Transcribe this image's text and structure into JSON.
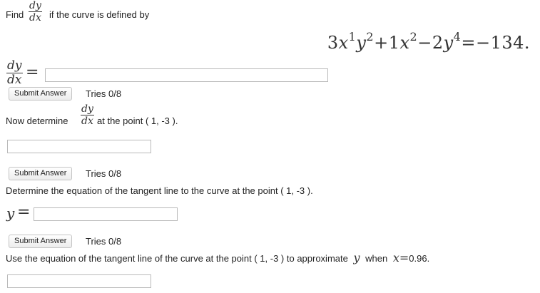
{
  "q1": {
    "find_word": "Find",
    "frac_num": "dy",
    "frac_den": "dx",
    "prompt_text": "if the curve is defined by",
    "equation": {
      "coef1": "3",
      "x1": "x",
      "exp_x1": "1",
      "y1": "y",
      "exp_y1": "2",
      "plus": "+1",
      "x2": "x",
      "exp_x2": "2",
      "minus": "−2",
      "y2": "y",
      "exp_y2": "4",
      "rhs": "=−134."
    },
    "answer_label_num": "dy",
    "answer_label_den": "dx",
    "equals": "=",
    "answer_value": "",
    "submit_label": "Submit Answer",
    "tries": "Tries 0/8"
  },
  "q2": {
    "prefix": "Now determine",
    "frac_num": "dy",
    "frac_den": "dx",
    "suffix": "at the point ( 1, -3 ).",
    "answer_value": "",
    "submit_label": "Submit Answer",
    "tries": "Tries 0/8"
  },
  "q3": {
    "prompt": "Determine the equation of the tangent line to the curve at the point ( 1, -3 ).",
    "y_label": "y",
    "equals": "=",
    "answer_value": "",
    "submit_label": "Submit Answer",
    "tries": "Tries 0/8"
  },
  "q4": {
    "prompt_prefix": "Use the equation of the tangent line of the curve at the point ( 1, -3 ) to approximate",
    "y_var": "y",
    "when_word": "when",
    "x_var": "x",
    "x_equals": "=",
    "x_value": "0.96.",
    "answer_value": ""
  }
}
